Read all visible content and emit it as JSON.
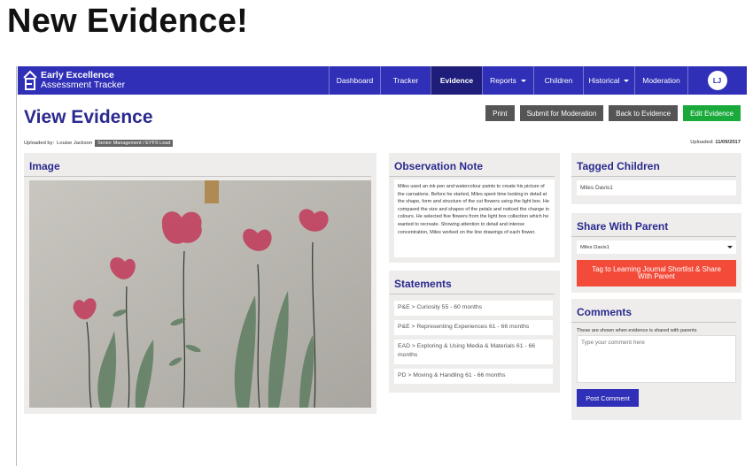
{
  "slide": {
    "title": "New Evidence!"
  },
  "brand": {
    "line1": "Early Excellence",
    "line2": "Assessment Tracker"
  },
  "nav": {
    "items": [
      {
        "label": "Dashboard"
      },
      {
        "label": "Tracker"
      },
      {
        "label": "Evidence"
      },
      {
        "label": "Reports"
      },
      {
        "label": "Children"
      },
      {
        "label": "Historical"
      },
      {
        "label": "Moderation"
      }
    ],
    "avatar_initials": "LJ"
  },
  "header": {
    "title": "View Evidence",
    "actions": {
      "print": "Print",
      "submit": "Submit for Moderation",
      "back": "Back to Evidence",
      "edit": "Edit Evidence"
    },
    "uploaded_by_label": "Uploaded by:",
    "uploaded_by_name": "Louise Jackson",
    "uploaded_by_role": "Senior Management / EYFS Lead",
    "uploaded_label": "Uploaded:",
    "uploaded_date": "11/09/2017"
  },
  "image_panel": {
    "title": "Image"
  },
  "observation": {
    "title": "Observation Note",
    "text": "Miles used an ink pen and watercolour paints to create his picture of the carnations. Before he started, Miles spent time looking in detail at the shape, form and structure of the cut flowers using the light box. He compared the size and shapes of the petals and noticed the change in colours. He selected five flowers from the light box collection which he wanted to recreate. Showing attention to detail and intense concentration, Miles worked on the line drawings of each flower."
  },
  "statements": {
    "title": "Statements",
    "items": [
      "P&E > Curiosity 55 - 60 months",
      "P&E > Representing Experiences 61 - 66 months",
      "EAD > Exploring & Using Media & Materials 61 - 66 months",
      "PD > Moving & Handling 61 - 66 months"
    ]
  },
  "tagged": {
    "title": "Tagged Children",
    "child": "Miles Davis1"
  },
  "share": {
    "title": "Share With Parent",
    "selected": "Miles Davis1",
    "button": "Tag to Learning Journal Shortlist & Share With Parent"
  },
  "comments": {
    "title": "Comments",
    "hint": "These are shown when evidence is shared with parents",
    "placeholder": "Type your comment here",
    "button": "Post Comment"
  },
  "colors": {
    "nav": "#2f2fb7",
    "nav_active": "#1e1e7a",
    "title": "#2a2a8e",
    "green": "#1aaa3c",
    "red": "#f24b3a"
  }
}
